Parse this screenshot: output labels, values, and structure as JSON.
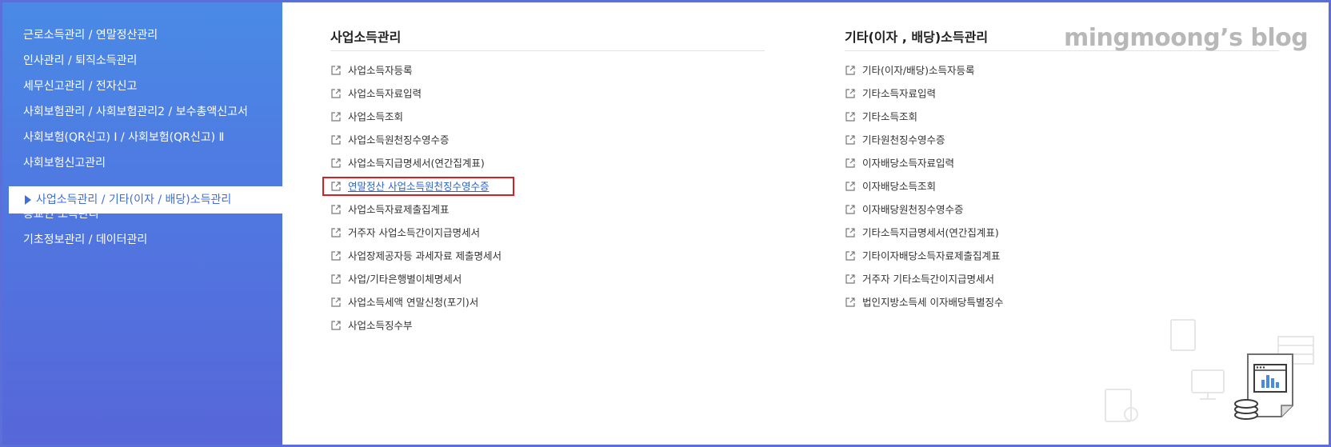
{
  "sidebar": {
    "items": [
      {
        "label": "근로소득관리 / 연말정산관리"
      },
      {
        "label": "인사관리 / 퇴직소득관리"
      },
      {
        "label": "세무신고관리 / 전자신고"
      },
      {
        "label": "사회보험관리 / 사회보험관리2 / 보수총액신고서"
      },
      {
        "label": "사회보험(QR신고) Ⅰ / 사회보험(QR신고) Ⅱ"
      },
      {
        "label": "사회보험신고관리"
      },
      {
        "label": "사업소득관리 / 기타(이자 / 배당)소득관리"
      },
      {
        "label": "종교인 소득관리"
      },
      {
        "label": "기초정보관리 / 데이터관리"
      }
    ]
  },
  "business": {
    "title": "사업소득관리",
    "links": [
      "사업소득자등록",
      "사업소득자료입력",
      "사업소득조회",
      "사업소득원천징수영수증",
      "사업소득지급명세서(연간집계표)",
      "연말정산 사업소득원천징수영수증",
      "사업소득자료제출집계표",
      "거주자 사업소득간이지급명세서",
      "사업장제공자등 과세자료 제출명세서",
      "사업/기타은행별이체명세서",
      "사업소득세액 연말신청(포기)서",
      "사업소득징수부"
    ]
  },
  "other": {
    "title": "기타(이자 , 배당)소득관리",
    "links": [
      "기타(이자/배당)소득자등록",
      "기타소득자료입력",
      "기타소득조회",
      "기타원천징수영수증",
      "이자배당소득자료입력",
      "이자배당소득조회",
      "이자배당원천징수영수증",
      "기타소득지급명세서(연간집계표)",
      "기타이자배당소득자료제출집계표",
      "거주자 기타소득간이지급명세서",
      "법인지방소득세 이자배당특별징수"
    ]
  },
  "watermark": "mingmoong’s blog",
  "colors": {
    "sidebar_top": "#4a8ae6",
    "sidebar_bottom": "#5767d8",
    "active_text": "#3f6fdc",
    "highlight_box": "#d42020",
    "highlight_link": "#2a63c9"
  },
  "icons": {
    "link_icon": "external-link-icon",
    "active_marker": "triangle-right-icon"
  }
}
